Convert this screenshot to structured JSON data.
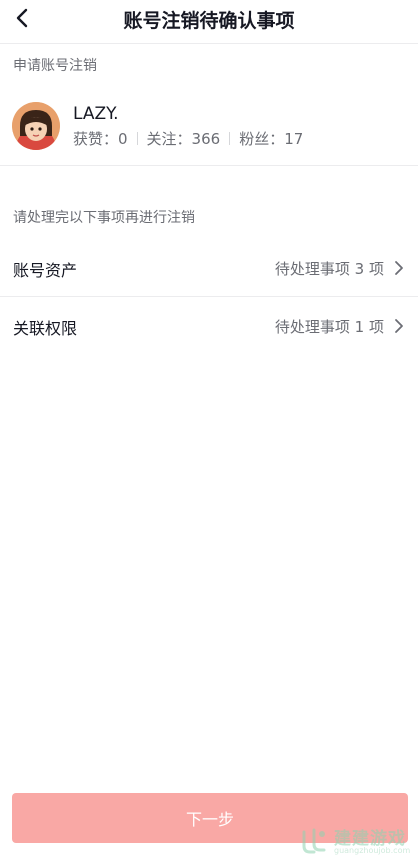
{
  "header": {
    "title": "账号注销待确认事项",
    "back_icon": "chevron-left-icon"
  },
  "apply_section": {
    "label": "申请账号注销"
  },
  "user": {
    "name": "LAZY.",
    "stats": [
      {
        "label": "获赞：0"
      },
      {
        "label": "关注：366"
      },
      {
        "label": "粉丝：17"
      }
    ]
  },
  "pending_section": {
    "label": "请处理完以下事项再进行注销",
    "items": [
      {
        "title": "账号资产",
        "value": "待处理事项 3 项"
      },
      {
        "title": "关联权限",
        "value": "待处理事项 1 项"
      }
    ]
  },
  "footer": {
    "next_label": "下一步"
  },
  "watermark": {
    "title": "建建游戏",
    "url": "guangzhoujob.com"
  },
  "colors": {
    "accent_button": "#f9a8a5",
    "text_primary": "#161823",
    "text_secondary": "#6b6d74",
    "divider": "#ececee"
  }
}
